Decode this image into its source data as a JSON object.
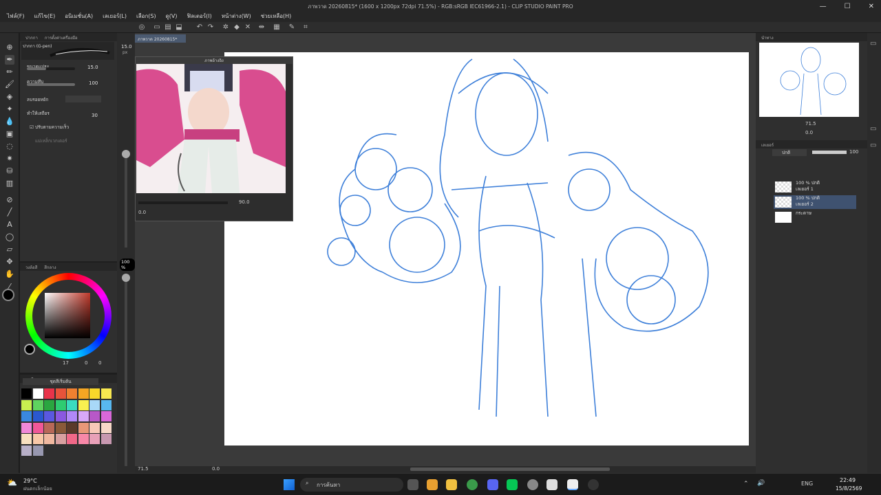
{
  "window": {
    "title": "ภาพวาด 20260815* (1600 x 1200px 72dpi 71.5%) - RGB:sRGB IEC61966-2.1) - CLIP STUDIO PAINT PRO"
  },
  "menu": [
    "ไฟล์(F)",
    "แก้ไข(E)",
    "อนิเมชั่น(A)",
    "เลเยอร์(L)",
    "เลือก(S)",
    "ดู(V)",
    "ฟิลเตอร์(I)",
    "หน้าต่าง(W)",
    "ช่วยเหลือ(H)"
  ],
  "subtool": {
    "tabs": [
      "ปากกา",
      "การตั้งค่าเครื่องมือ"
    ],
    "brush_name": "ปากกา (G-pen)",
    "size_label": "ขนาดแปรง",
    "size_value": "15.0",
    "opacity_label": "ความทึบ",
    "opacity_value": "100",
    "antialias_label": "ลบรอยหยัก",
    "stabilize_label": "ทำให้เสถียร",
    "stabilize_value": "30",
    "speed_label": "ปรับตามความเร็ว",
    "vector_label": "แม่เหล็กเวกเตอร์",
    "brush_size_badge": "15.0",
    "brush_size_unit": "px"
  },
  "color": {
    "tabs": [
      "วงล้อสี",
      "สีกลาง"
    ],
    "values": [
      "17",
      "0",
      "0"
    ],
    "current": "#000000"
  },
  "palette": {
    "tabs": [
      "ชุดสี"
    ],
    "name": "ชุดสีเริ่มต้น",
    "swatches": [
      "#000000",
      "#ffffff",
      "#e8334a",
      "#e8533a",
      "#f08030",
      "#f5a623",
      "#f8d82a",
      "#f8e850",
      "#c8f050",
      "#5fd35f",
      "#2aa640",
      "#2ecc71",
      "#3adbc0",
      "#f8f050",
      "#a8d8f8",
      "#58b8f0",
      "#3a88e0",
      "#2a58d0",
      "#5a58e0",
      "#8a58e0",
      "#b088f8",
      "#d8a8f8",
      "#b858c8",
      "#d868d8",
      "#f088d8",
      "#f05898",
      "#b86858",
      "#8a5a3a",
      "#5a3a2a",
      "#e89878",
      "#f8c8b8",
      "#f8d8c8",
      "#f8e0c0",
      "#f8c8a8",
      "#f0b8a0",
      "#d8a0a0",
      "#f06888",
      "#f888a8",
      "#e8a0b8",
      "#c898b0",
      "#b8b0c8",
      "#9898b0"
    ]
  },
  "canvas": {
    "tab": "ภาพวาด 20260815*",
    "zoom": "71.5",
    "angle": "0.0"
  },
  "navigator": {
    "title": "ภาพอ้างอิง",
    "zoom": "90.0",
    "angle": "0.0"
  },
  "opacity_badge": "100 %",
  "rightpanel": {
    "nav_tab": "นำทาง",
    "zoom": "71.5",
    "angle": "0.0",
    "layer_tab": "เลเยอร์",
    "blend": "ปกติ",
    "opacity": "100",
    "layers": [
      {
        "line1": "100 % ปกติ",
        "line2": "เลเยอร์ 1"
      },
      {
        "line1": "100 % ปกติ",
        "line2": "เลเยอร์ 2"
      },
      {
        "line1": "",
        "line2": "กระดาษ"
      }
    ]
  },
  "taskbar": {
    "temp": "29°C",
    "weather": "ฝนตกเล็กน้อย",
    "search": "การค้นหา",
    "lang": "ENG",
    "time": "22:49",
    "date": "15/8/2569"
  }
}
